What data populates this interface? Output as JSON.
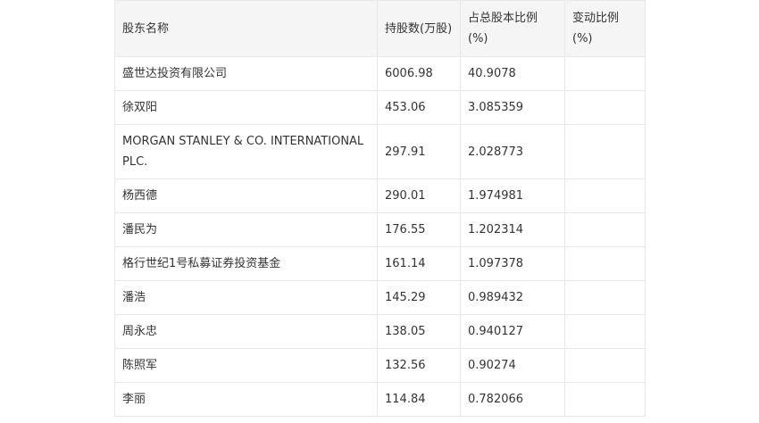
{
  "table": {
    "headers": [
      "股东名称",
      "持股数(万股)",
      "占总股本比例(%)",
      "变动比例(%)"
    ],
    "rows": [
      [
        "盛世达投资有限公司",
        "6006.98",
        "40.9078",
        ""
      ],
      [
        "徐双阳",
        "453.06",
        "3.085359",
        ""
      ],
      [
        "MORGAN STANLEY & CO. INTERNATIONAL PLC.",
        "297.91",
        "2.028773",
        ""
      ],
      [
        "杨西德",
        "290.01",
        "1.974981",
        ""
      ],
      [
        "潘民为",
        "176.55",
        "1.202314",
        ""
      ],
      [
        "格行世纪1号私募证券投资基金",
        "161.14",
        "1.097378",
        ""
      ],
      [
        "潘浩",
        "145.29",
        "0.989432",
        ""
      ],
      [
        "周永忠",
        "138.05",
        "0.940127",
        ""
      ],
      [
        "陈照军",
        "132.56",
        "0.90274",
        ""
      ],
      [
        "李丽",
        "114.84",
        "0.782066",
        ""
      ]
    ]
  }
}
